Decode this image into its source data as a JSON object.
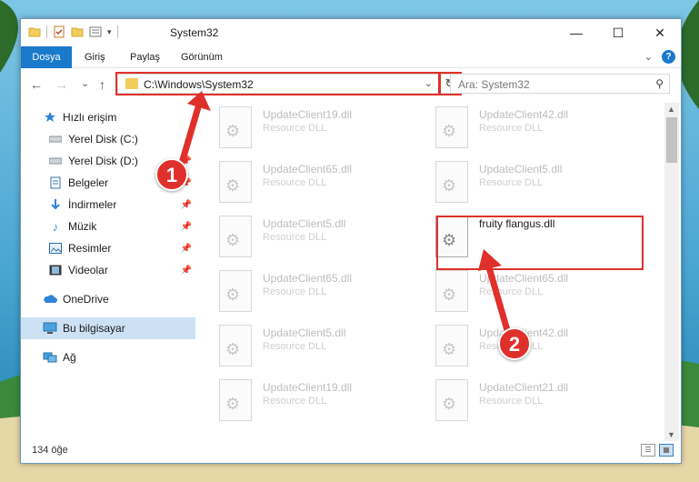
{
  "window": {
    "title": "System32",
    "quick_access_icons": [
      "folder-icon",
      "checklist-icon",
      "folder-icon",
      "properties-icon",
      "dropdown-icon"
    ],
    "caption": {
      "minimize": "—",
      "maximize": "☐",
      "close": "✕"
    }
  },
  "ribbon": {
    "tabs": [
      {
        "label": "Dosya",
        "active": true
      },
      {
        "label": "Giriş"
      },
      {
        "label": "Paylaş"
      },
      {
        "label": "Görünüm"
      }
    ],
    "expand_icon": "chevron-down-icon",
    "help": "?"
  },
  "nav": {
    "back": "←",
    "forward": "→",
    "recent": "⌄",
    "up": "↑",
    "address": "C:\\Windows\\System32",
    "search_placeholder": "Ara: System32"
  },
  "sidebar": {
    "items": [
      {
        "label": "Hızlı erişim",
        "icon": "star-icon"
      },
      {
        "label": "Yerel Disk (C:)",
        "icon": "drive-icon",
        "pinned": true
      },
      {
        "label": "Yerel Disk (D:)",
        "icon": "drive-icon",
        "pinned": true
      },
      {
        "label": "Belgeler",
        "icon": "documents-icon",
        "pinned": true
      },
      {
        "label": "İndirmeler",
        "icon": "download-icon",
        "pinned": true
      },
      {
        "label": "Müzik",
        "icon": "music-icon",
        "pinned": true
      },
      {
        "label": "Resimler",
        "icon": "pictures-icon",
        "pinned": true
      },
      {
        "label": "Videolar",
        "icon": "videos-icon",
        "pinned": true
      },
      {
        "label": "OneDrive",
        "icon": "cloud-icon"
      },
      {
        "label": "Bu bilgisayar",
        "icon": "computer-icon",
        "selected": true
      },
      {
        "label": "Ağ",
        "icon": "network-icon"
      }
    ]
  },
  "files": {
    "left": [
      {
        "name": "UpdateClient19.dll",
        "desc": "Resource DLL"
      },
      {
        "name": "UpdateClient65.dll",
        "desc": "Resource DLL"
      },
      {
        "name": "UpdateClient5.dll",
        "desc": "Resource DLL"
      },
      {
        "name": "UpdateClient65.dll",
        "desc": "Resource DLL"
      },
      {
        "name": "UpdateClient5.dll",
        "desc": "Resource DLL"
      },
      {
        "name": "UpdateClient19.dll",
        "desc": "Resource DLL"
      }
    ],
    "right": [
      {
        "name": "UpdateClient42.dll",
        "desc": "Resource DLL"
      },
      {
        "name": "UpdateClient5.dll",
        "desc": "Resource DLL"
      },
      {
        "name": "fruity flangus.dll",
        "desc": "",
        "focused": true
      },
      {
        "name": "UpdateClient65.dll",
        "desc": "Resource DLL"
      },
      {
        "name": "UpdateClient42.dll",
        "desc": "Resource DLL"
      },
      {
        "name": "UpdateClient21.dll",
        "desc": "Resource DLL"
      }
    ]
  },
  "status": {
    "count": "134 öğe"
  },
  "annotations": {
    "step1": "1",
    "step2": "2",
    "highlight_color": "#e0302b"
  }
}
